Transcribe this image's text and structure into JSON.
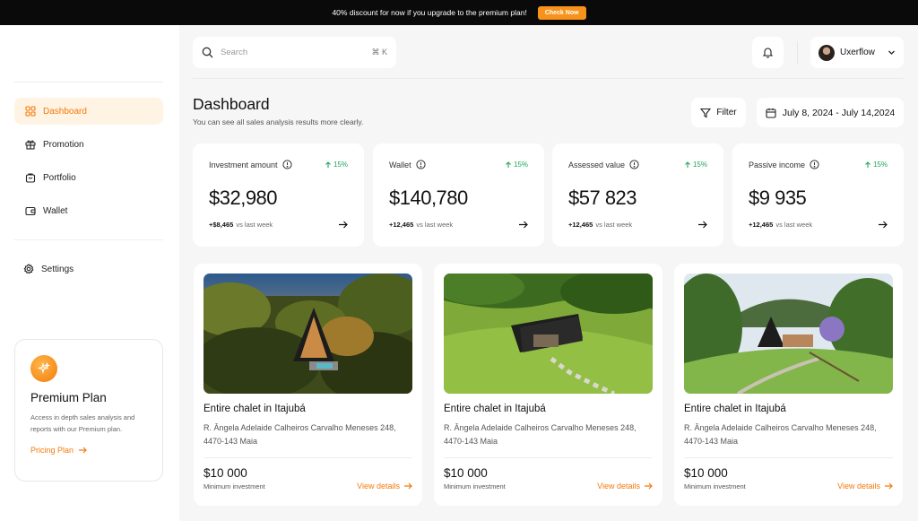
{
  "banner": {
    "text": "40% discount for now if you upgrade to the premium plan!",
    "button": "Check Now"
  },
  "sidebar": {
    "items": [
      {
        "label": "Dashboard",
        "icon": "grid-icon"
      },
      {
        "label": "Promotion",
        "icon": "gift-icon"
      },
      {
        "label": "Portfolio",
        "icon": "bag-icon"
      },
      {
        "label": "Wallet",
        "icon": "wallet-icon"
      }
    ],
    "settings": {
      "label": "Settings",
      "icon": "gear-icon"
    },
    "premium": {
      "title": "Premium Plan",
      "description": "Access in depth sales analysis and reports with our Premium plan.",
      "link": "Pricing Plan"
    }
  },
  "topbar": {
    "search_placeholder": "Search",
    "shortcut": "⌘ K",
    "user_name": "Uxerflow"
  },
  "header": {
    "title": "Dashboard",
    "subtitle": "You can see all sales analysis results more clearly.",
    "filter": "Filter",
    "date_range": "July 8, 2024 - July 14,2024"
  },
  "stats": [
    {
      "label": "Investment amount",
      "change": "15%",
      "value": "$32,980",
      "delta": "+$8,465",
      "vs": "vs last week"
    },
    {
      "label": "Wallet",
      "change": "15%",
      "value": "$140,780",
      "delta": "+12,465",
      "vs": "vs last week"
    },
    {
      "label": "Assessed value",
      "change": "15%",
      "value": "$57 823",
      "delta": "+12,465",
      "vs": "vs last week"
    },
    {
      "label": "Passive income",
      "change": "15%",
      "value": "$9 935",
      "delta": "+12,465",
      "vs": "vs last week"
    }
  ],
  "listings": [
    {
      "title": "Entire chalet in Itajubá",
      "address": "R. Ângela Adelaide Calheiros Carvalho Meneses 248, 4470-143 Maia",
      "price": "$10 000",
      "price_label": "Minimum investment",
      "link": "View details"
    },
    {
      "title": "Entire chalet in Itajubá",
      "address": "R. Ângela Adelaide Calheiros Carvalho Meneses 248, 4470-143 Maia",
      "price": "$10 000",
      "price_label": "Minimum investment",
      "link": "View details"
    },
    {
      "title": "Entire chalet in Itajubá",
      "address": "R. Ângela Adelaide Calheiros Carvalho Meneses 248, 4470-143 Maia",
      "price": "$10 000",
      "price_label": "Minimum investment",
      "link": "View details"
    }
  ],
  "colors": {
    "accent": "#f27a0c",
    "positive": "#1ea65b",
    "banner_bg": "#0a0a0a"
  }
}
